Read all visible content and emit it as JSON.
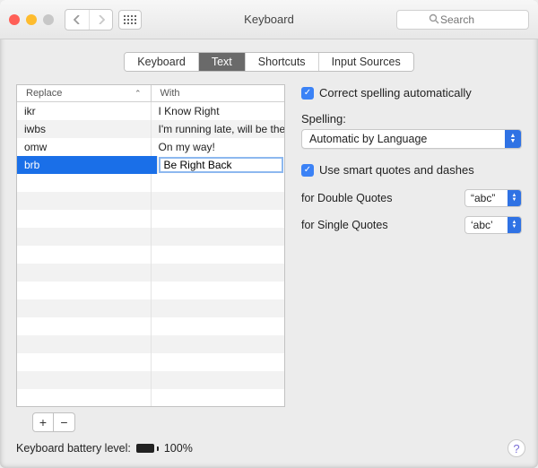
{
  "window": {
    "title": "Keyboard"
  },
  "search": {
    "placeholder": "Search"
  },
  "tabs": [
    {
      "label": "Keyboard",
      "active": false
    },
    {
      "label": "Text",
      "active": true
    },
    {
      "label": "Shortcuts",
      "active": false
    },
    {
      "label": "Input Sources",
      "active": false
    }
  ],
  "table": {
    "col_replace": "Replace",
    "col_with": "With",
    "rows": [
      {
        "replace": "ikr",
        "with": "I Know Right"
      },
      {
        "replace": "iwbs",
        "with": "I'm running late, will be the..."
      },
      {
        "replace": "omw",
        "with": "On my way!"
      },
      {
        "replace": "brb",
        "with": "Be Right Back"
      }
    ],
    "editing_row": 3
  },
  "options": {
    "correct_spelling_label": "Correct spelling automatically",
    "correct_spelling_checked": true,
    "spelling_heading": "Spelling:",
    "spelling_value": "Automatic by Language",
    "smart_quotes_label": "Use smart quotes and dashes",
    "smart_quotes_checked": true,
    "double_quotes_label": "for Double Quotes",
    "double_quotes_value": "“abc”",
    "single_quotes_label": "for Single Quotes",
    "single_quotes_value": "‘abc’"
  },
  "footer": {
    "battery_label": "Keyboard battery level:",
    "battery_value": "100%"
  }
}
